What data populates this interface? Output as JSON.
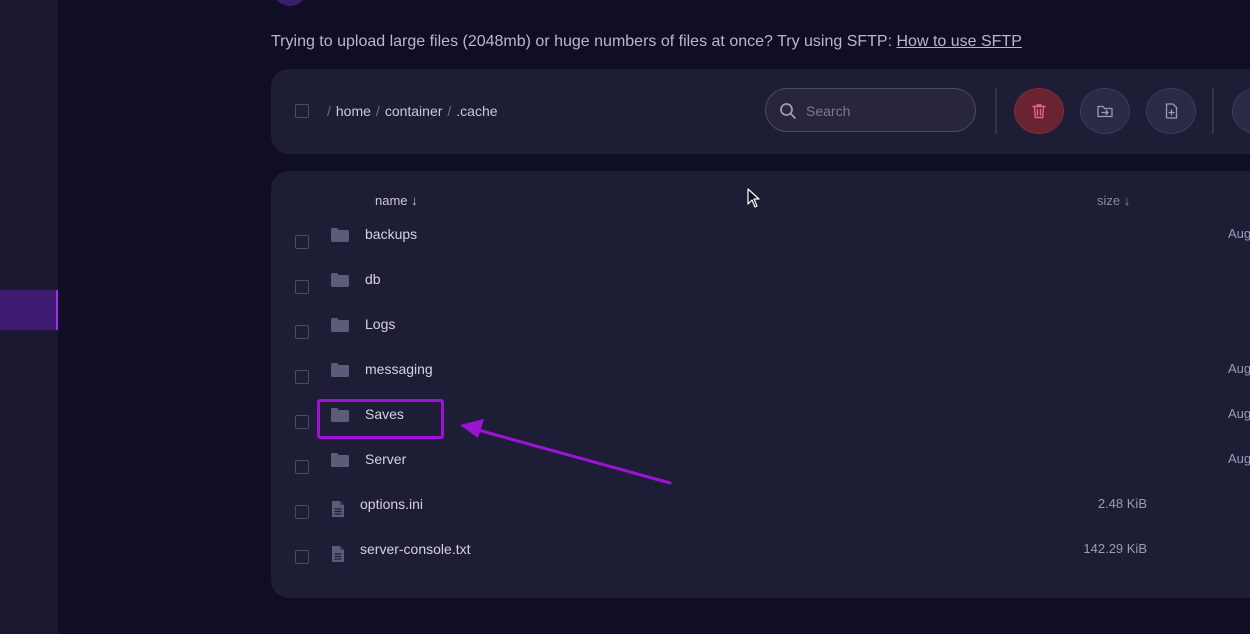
{
  "notice": {
    "text": "Trying to upload large files (2048mb) or huge numbers of files at once? Try using SFTP: ",
    "link": "How to use SFTP"
  },
  "breadcrumb": {
    "separator": "/",
    "segments": [
      "home",
      "container",
      ".cache"
    ]
  },
  "search": {
    "placeholder": "Search"
  },
  "toolbar": {
    "buttons": [
      {
        "name": "delete",
        "icon": "trash-icon",
        "color": "#6b2332"
      },
      {
        "name": "move",
        "icon": "folder-move-icon"
      },
      {
        "name": "new-file",
        "icon": "file-add-icon"
      }
    ]
  },
  "table": {
    "columns": {
      "name": "name ↓",
      "size": "size ↓"
    },
    "rows": [
      {
        "type": "folder",
        "name": "backups",
        "size": "",
        "date": "Aug"
      },
      {
        "type": "folder",
        "name": "db",
        "size": "",
        "date": ""
      },
      {
        "type": "folder",
        "name": "Logs",
        "size": "",
        "date": ""
      },
      {
        "type": "folder",
        "name": "messaging",
        "size": "",
        "date": "Aug"
      },
      {
        "type": "folder",
        "name": "Saves",
        "size": "",
        "date": "Aug"
      },
      {
        "type": "folder",
        "name": "Server",
        "size": "",
        "date": "Aug"
      },
      {
        "type": "file",
        "name": "options.ini",
        "size": "2.48 KiB",
        "date": ""
      },
      {
        "type": "file",
        "name": "server-console.txt",
        "size": "142.29 KiB",
        "date": ""
      }
    ]
  },
  "annotation": {
    "highlighted_item": "Saves",
    "color": "#9b14d4"
  },
  "colors": {
    "background": "#0f0e24",
    "panel": "#1e1d36",
    "accent": "#a22fe3",
    "danger": "#6b2332"
  }
}
